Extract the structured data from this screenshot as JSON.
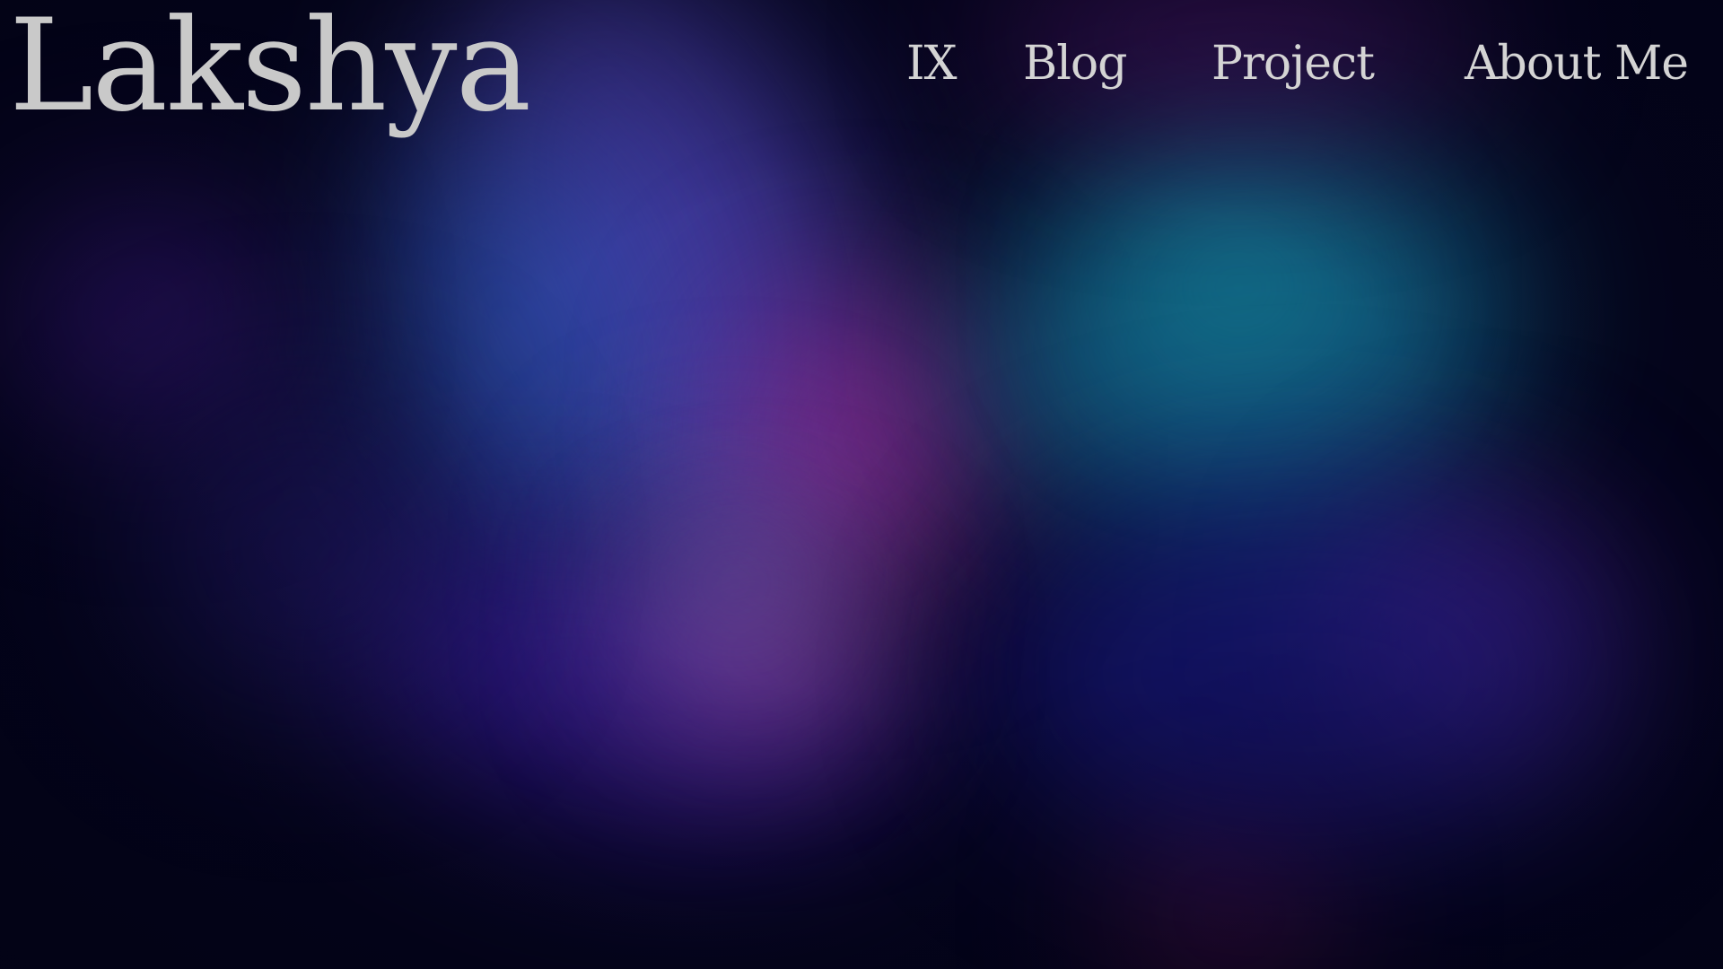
{
  "site": {
    "logo": "Lakshya"
  },
  "nav": {
    "items": [
      {
        "label": "IX"
      },
      {
        "label": "Blog"
      },
      {
        "label": "Project"
      },
      {
        "label": "About Me"
      }
    ]
  },
  "theme": {
    "background": "#04041c",
    "text_color": "#c9c9c9",
    "accent_colors": [
      "#5046be",
      "#962896",
      "#146e96",
      "#3c1eaa"
    ]
  }
}
